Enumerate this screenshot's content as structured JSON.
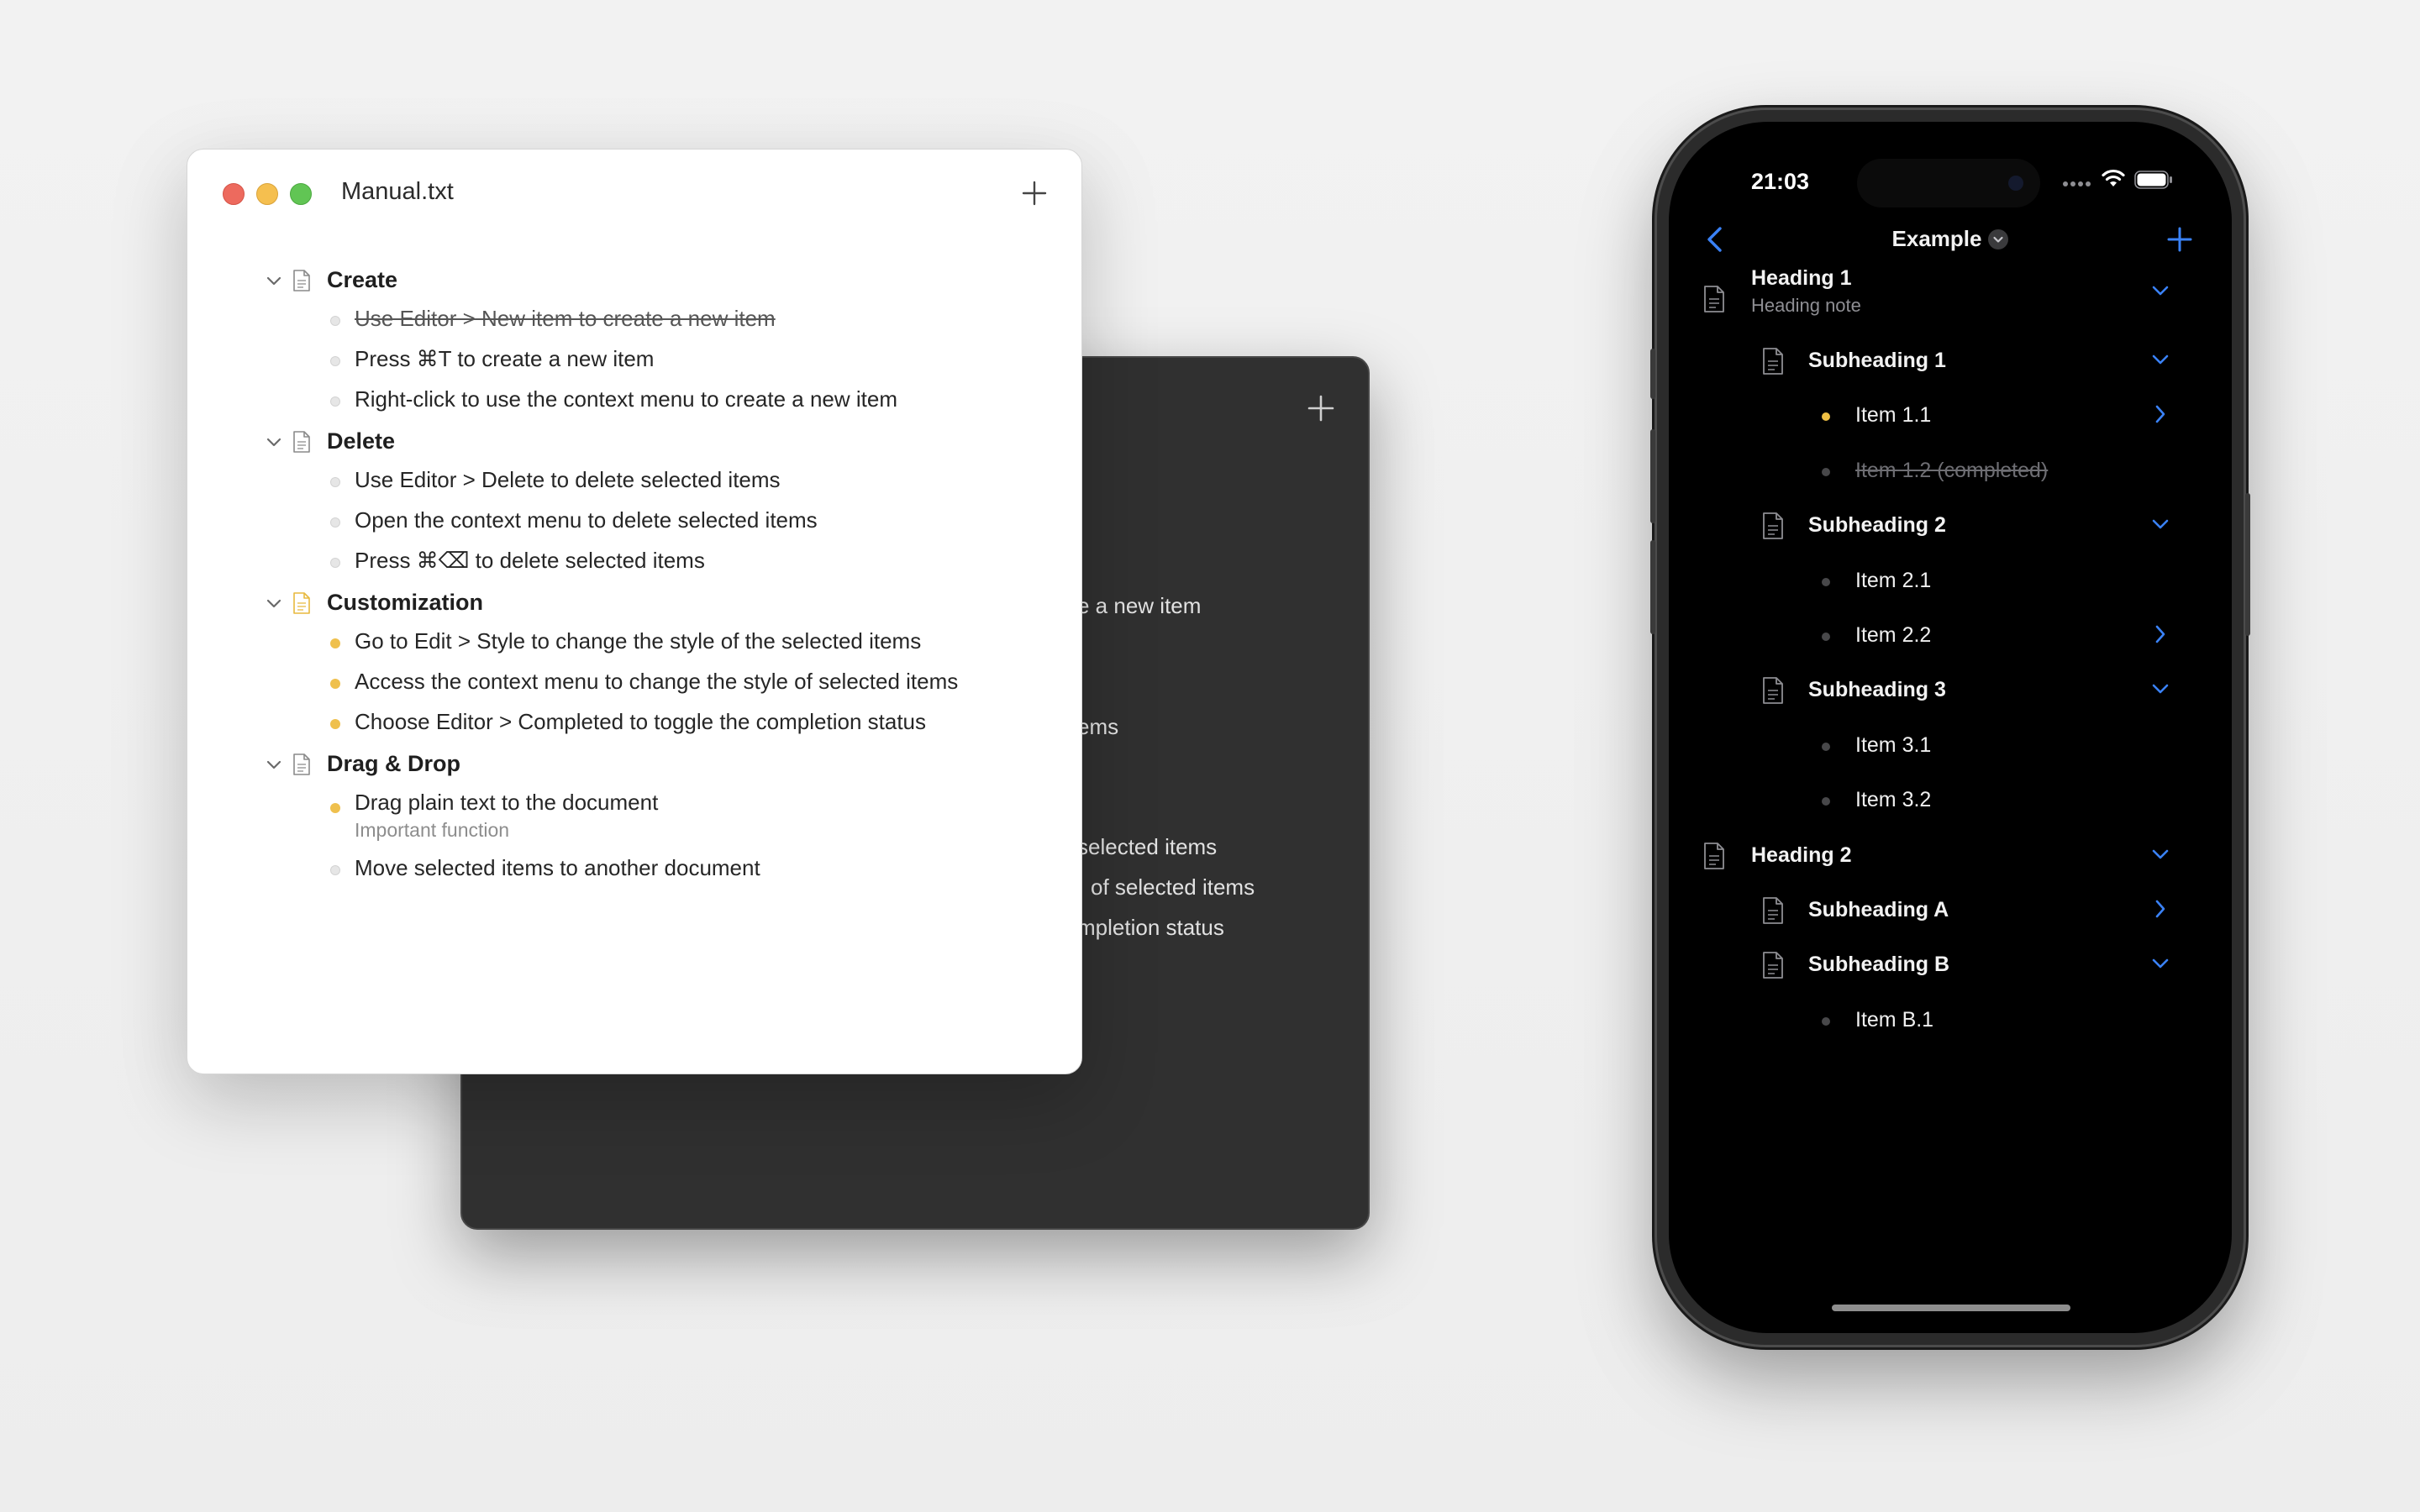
{
  "dark_window": {
    "fragments": [
      "e a new item",
      "ems",
      "selected items",
      "of selected items",
      "mpletion status"
    ]
  },
  "mac_window": {
    "title": "Manual.txt",
    "outline": [
      {
        "heading": "Create",
        "icon_color": "#8a8a8a",
        "items": [
          {
            "text": "Use Editor > New item to create a new item",
            "completed": true,
            "bullet": "gray"
          },
          {
            "text": "Press ⌘T to create a new item",
            "completed": false,
            "bullet": "gray"
          },
          {
            "text": "Right-click to use the context menu to create a new item",
            "completed": false,
            "bullet": "gray"
          }
        ]
      },
      {
        "heading": "Delete",
        "icon_color": "#8a8a8a",
        "items": [
          {
            "text": "Use Editor > Delete to delete selected items",
            "completed": false,
            "bullet": "gray"
          },
          {
            "text": "Open the context menu to delete selected items",
            "completed": false,
            "bullet": "gray"
          },
          {
            "text": "Press ⌘⌫ to delete selected items",
            "completed": false,
            "bullet": "gray"
          }
        ]
      },
      {
        "heading": "Customization",
        "icon_color": "#e8b93e",
        "items": [
          {
            "text": "Go to Edit > Style to change the style of the selected items",
            "completed": false,
            "bullet": "yellow"
          },
          {
            "text": "Access the context menu to change the style of selected items",
            "completed": false,
            "bullet": "yellow"
          },
          {
            "text": "Choose Editor > Completed to toggle the completion status",
            "completed": false,
            "bullet": "yellow"
          }
        ]
      },
      {
        "heading": "Drag & Drop",
        "icon_color": "#8a8a8a",
        "items": [
          {
            "text": "Drag plain text to the document",
            "note": "Important function",
            "completed": false,
            "bullet": "yellow"
          },
          {
            "text": "Move selected items to another document",
            "completed": false,
            "bullet": "gray"
          }
        ]
      }
    ]
  },
  "phone": {
    "status_time": "21:03",
    "nav_title": "Example",
    "accent": "#3a82f7",
    "rows": [
      {
        "kind": "heading",
        "level": 0,
        "text": "Heading 1",
        "note": "Heading note",
        "chevron": "down"
      },
      {
        "kind": "heading",
        "level": 1,
        "text": "Subheading 1",
        "chevron": "down"
      },
      {
        "kind": "item",
        "level": 2,
        "text": "Item 1.1",
        "bullet": "yellow",
        "chevron": "right"
      },
      {
        "kind": "item",
        "level": 2,
        "text": "Item 1.2 (completed)",
        "bullet": "gray",
        "completed": true
      },
      {
        "kind": "heading",
        "level": 1,
        "text": "Subheading 2",
        "chevron": "down"
      },
      {
        "kind": "item",
        "level": 2,
        "text": "Item 2.1",
        "bullet": "gray"
      },
      {
        "kind": "item",
        "level": 2,
        "text": "Item 2.2",
        "bullet": "gray",
        "chevron": "right"
      },
      {
        "kind": "heading",
        "level": 1,
        "text": "Subheading 3",
        "chevron": "down"
      },
      {
        "kind": "item",
        "level": 2,
        "text": "Item 3.1",
        "bullet": "gray"
      },
      {
        "kind": "item",
        "level": 2,
        "text": "Item 3.2",
        "bullet": "gray"
      },
      {
        "kind": "heading",
        "level": 0,
        "text": "Heading 2",
        "chevron": "down"
      },
      {
        "kind": "heading",
        "level": 1,
        "text": "Subheading A",
        "chevron": "right"
      },
      {
        "kind": "heading",
        "level": 1,
        "text": "Subheading B",
        "chevron": "down"
      },
      {
        "kind": "item",
        "level": 2,
        "text": "Item B.1",
        "bullet": "gray"
      }
    ]
  }
}
